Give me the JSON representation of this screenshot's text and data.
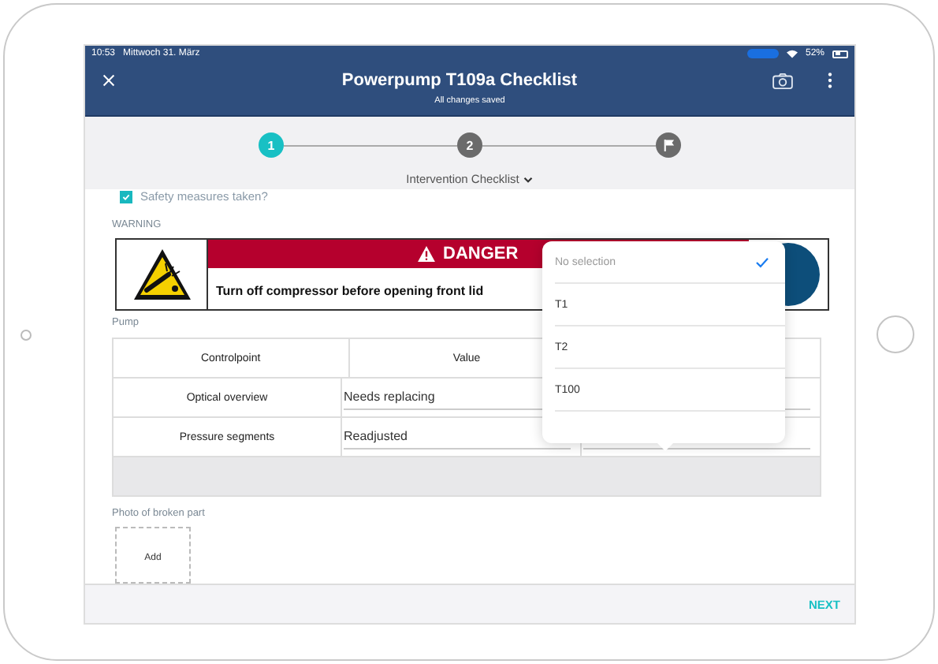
{
  "status_bar": {
    "time": "10:53",
    "date": "Mittwoch 31. März",
    "battery": "52%"
  },
  "header": {
    "title": "Powerpump T109a Checklist",
    "subtitle": "All changes saved"
  },
  "stepper": {
    "steps": [
      {
        "kind": "number",
        "label": "1",
        "selected": true
      },
      {
        "kind": "number",
        "label": "2",
        "selected": false
      },
      {
        "kind": "flag",
        "selected": false
      }
    ],
    "section": "Intervention Checklist"
  },
  "checkbox": {
    "label": "Safety measures taken?",
    "checked": true
  },
  "warning": {
    "label": "WARNING",
    "banner": "DANGER",
    "message": "Turn off compressor before opening front lid"
  },
  "pump": {
    "label": "Pump",
    "columns": [
      "Controlpoint",
      "Value"
    ],
    "rows": [
      {
        "controlpoint": "Optical overview",
        "value": "Needs replacing"
      },
      {
        "controlpoint": "Pressure segments",
        "value": "Readjusted"
      }
    ]
  },
  "dropdown": {
    "options": [
      {
        "kind": "none",
        "label": "No selection",
        "selected": true
      },
      {
        "kind": "option",
        "label": "T1",
        "selected": false
      },
      {
        "kind": "option",
        "label": "T2",
        "selected": false
      },
      {
        "kind": "option",
        "label": "T100",
        "selected": false
      }
    ]
  },
  "photo": {
    "label": "Photo of broken part",
    "button": "Add"
  },
  "footer": {
    "next": "NEXT"
  }
}
